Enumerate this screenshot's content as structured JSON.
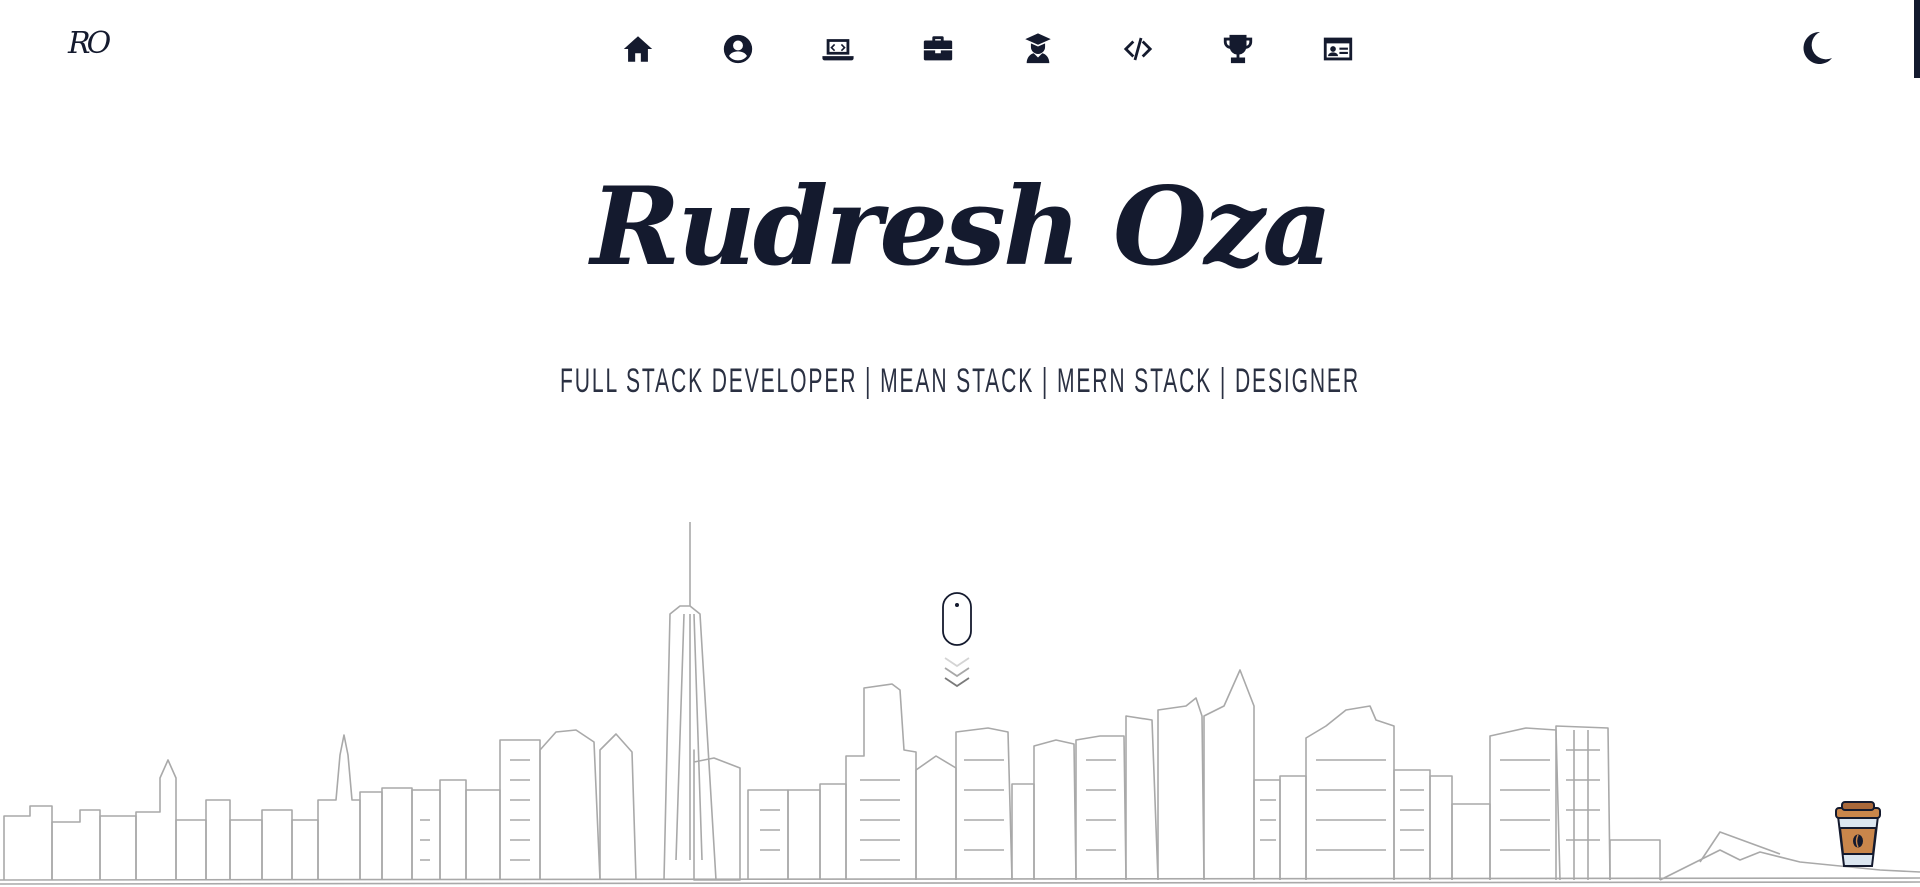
{
  "header": {
    "logo": "RO"
  },
  "nav": {
    "items": [
      {
        "name": "home",
        "icon": "home-icon"
      },
      {
        "name": "about",
        "icon": "user-circle-icon"
      },
      {
        "name": "projects",
        "icon": "laptop-code-icon"
      },
      {
        "name": "experience",
        "icon": "briefcase-icon"
      },
      {
        "name": "education",
        "icon": "graduation-icon"
      },
      {
        "name": "skills",
        "icon": "code-icon"
      },
      {
        "name": "achievements",
        "icon": "trophy-icon"
      },
      {
        "name": "contact",
        "icon": "id-card-icon"
      }
    ]
  },
  "theme_toggle": {
    "icon": "moon-icon"
  },
  "hero": {
    "title": "Rudresh Oza",
    "subtitle": "FULL STACK DEVELOPER | MEAN STACK | MERN STACK | DESIGNER"
  },
  "scroll_indicator": {
    "icon": "mouse-scroll-icon"
  },
  "footer_widget": {
    "icon": "coffee-cup-icon"
  },
  "colors": {
    "primary": "#141a2e",
    "background": "#ffffff",
    "skyline": "#a9a9a9",
    "coffee": "#c9864b"
  }
}
